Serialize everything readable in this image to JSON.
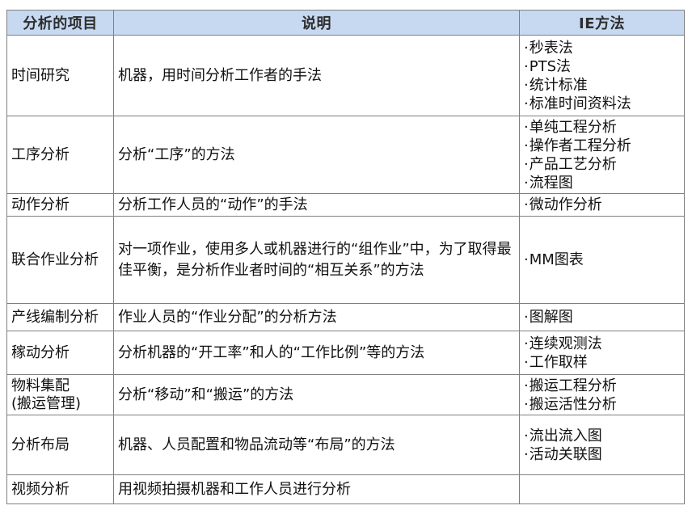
{
  "table": {
    "headers": {
      "item": "分析的项目",
      "description": "说明",
      "ie_methods": "IE方法"
    },
    "rows": [
      {
        "item": "时间研究",
        "description": "机器，用时间分析工作者的手法",
        "methods": [
          "秒表法",
          "PTS法",
          "统计标准",
          "标准时间资料法"
        ]
      },
      {
        "item": "工序分析",
        "description": "分析“工序”的方法",
        "methods": [
          "单纯工程分析",
          "操作者工程分析",
          "产品工艺分析",
          "流程图"
        ]
      },
      {
        "item": "动作分析",
        "description": "分析工作人员的“动作”的手法",
        "methods": [
          "微动作分析"
        ]
      },
      {
        "item": "联合作业分析",
        "description": "对一项作业，使用多人或机器进行的“组作业”中，为了取得最佳平衡，是分析作业者时间的“相互关系”的方法",
        "methods": [
          "MM图表"
        ]
      },
      {
        "item": "产线编制分析",
        "description": "作业人员的“作业分配”的分析方法",
        "methods": [
          "图解图"
        ]
      },
      {
        "item": "稼动分析",
        "description": "分析机器的“开工率”和人的“工作比例”等的方法",
        "methods": [
          "连续观测法",
          "工作取样"
        ]
      },
      {
        "item": "物料集配\n(搬运管理)",
        "description": "分析“移动”和“搬运”的方法",
        "methods": [
          "搬运工程分析",
          "搬运活性分析"
        ]
      },
      {
        "item": "分析布局",
        "description": "机器、人员配置和物品流动等“布局”的方法",
        "methods": [
          "流出流入图",
          "活动关联图"
        ]
      },
      {
        "item": "视频分析",
        "description": "用视频拍摄机器和工作人员进行分析",
        "methods": []
      }
    ]
  }
}
